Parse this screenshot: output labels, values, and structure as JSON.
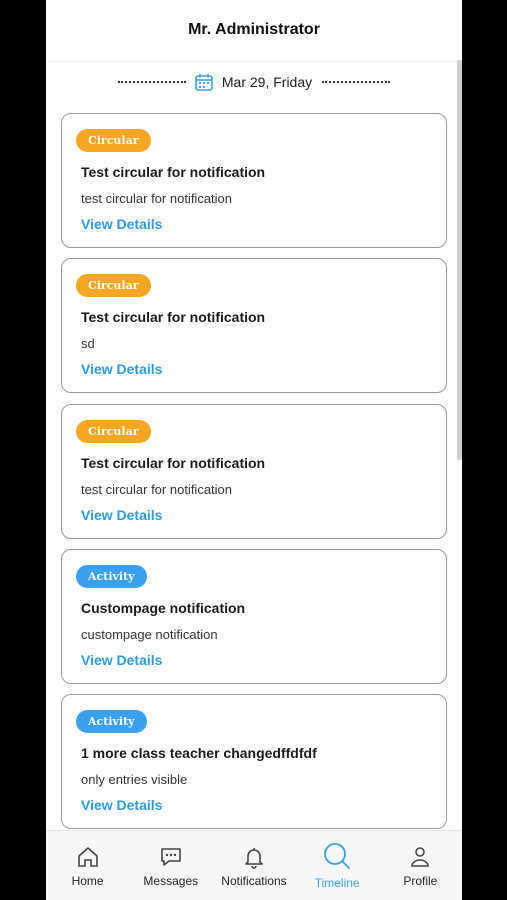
{
  "header": {
    "title": "Mr. Administrator"
  },
  "timeline": {
    "date_label": "Mar 29, Friday",
    "cards": [
      {
        "badge": "Circular",
        "badge_type": "circular",
        "title": "Test circular for notification",
        "description": "test circular for notification",
        "link": "View Details"
      },
      {
        "badge": "Circular",
        "badge_type": "circular",
        "title": "Test circular for notification",
        "description": "sd",
        "link": "View Details"
      },
      {
        "badge": "Circular",
        "badge_type": "circular",
        "title": "Test circular for notification",
        "description": "test circular for notification",
        "link": "View Details"
      },
      {
        "badge": "Activity",
        "badge_type": "activity",
        "title": "Custompage notification",
        "description": "custompage notification",
        "link": "View Details"
      },
      {
        "badge": "Activity",
        "badge_type": "activity",
        "title": "1 more class teacher changedffdfdf",
        "description": "only entries visible",
        "link": "View Details"
      }
    ]
  },
  "tabbar": {
    "items": [
      {
        "label": "Home",
        "icon": "home-icon"
      },
      {
        "label": "Messages",
        "icon": "chat-icon"
      },
      {
        "label": "Notifications",
        "icon": "bell-icon"
      },
      {
        "label": "Timeline",
        "icon": "search-icon",
        "active": true
      },
      {
        "label": "Profile",
        "icon": "user-icon"
      }
    ]
  },
  "colors": {
    "accent_blue": "#3aa0ee",
    "circular_badge": "#f5a623",
    "activity_badge": "#3aa0ee",
    "link": "#2d9be3"
  }
}
